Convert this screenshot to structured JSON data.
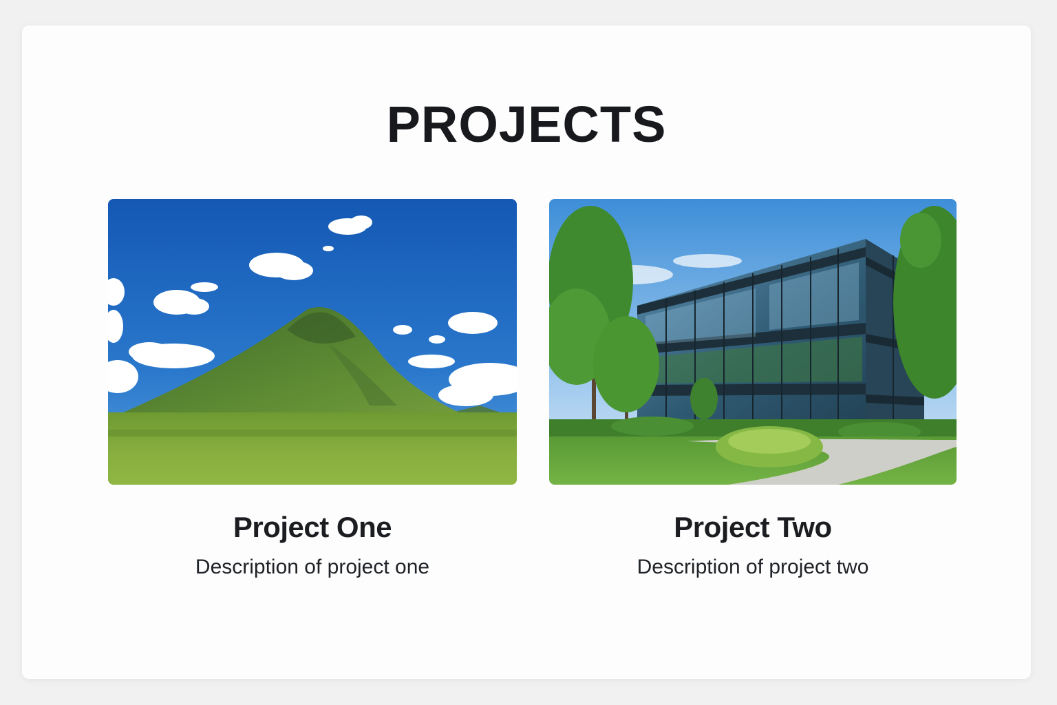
{
  "page": {
    "heading": "PROJECTS"
  },
  "projects": [
    {
      "title": "Project One",
      "description": "Description of project one",
      "image": "mountain-landscape-photo"
    },
    {
      "title": "Project Two",
      "description": "Description of project two",
      "image": "glass-office-building-photo"
    }
  ],
  "colors": {
    "background": "#f1f1f2",
    "card": "#fdfdfe",
    "text": "#17191c"
  }
}
